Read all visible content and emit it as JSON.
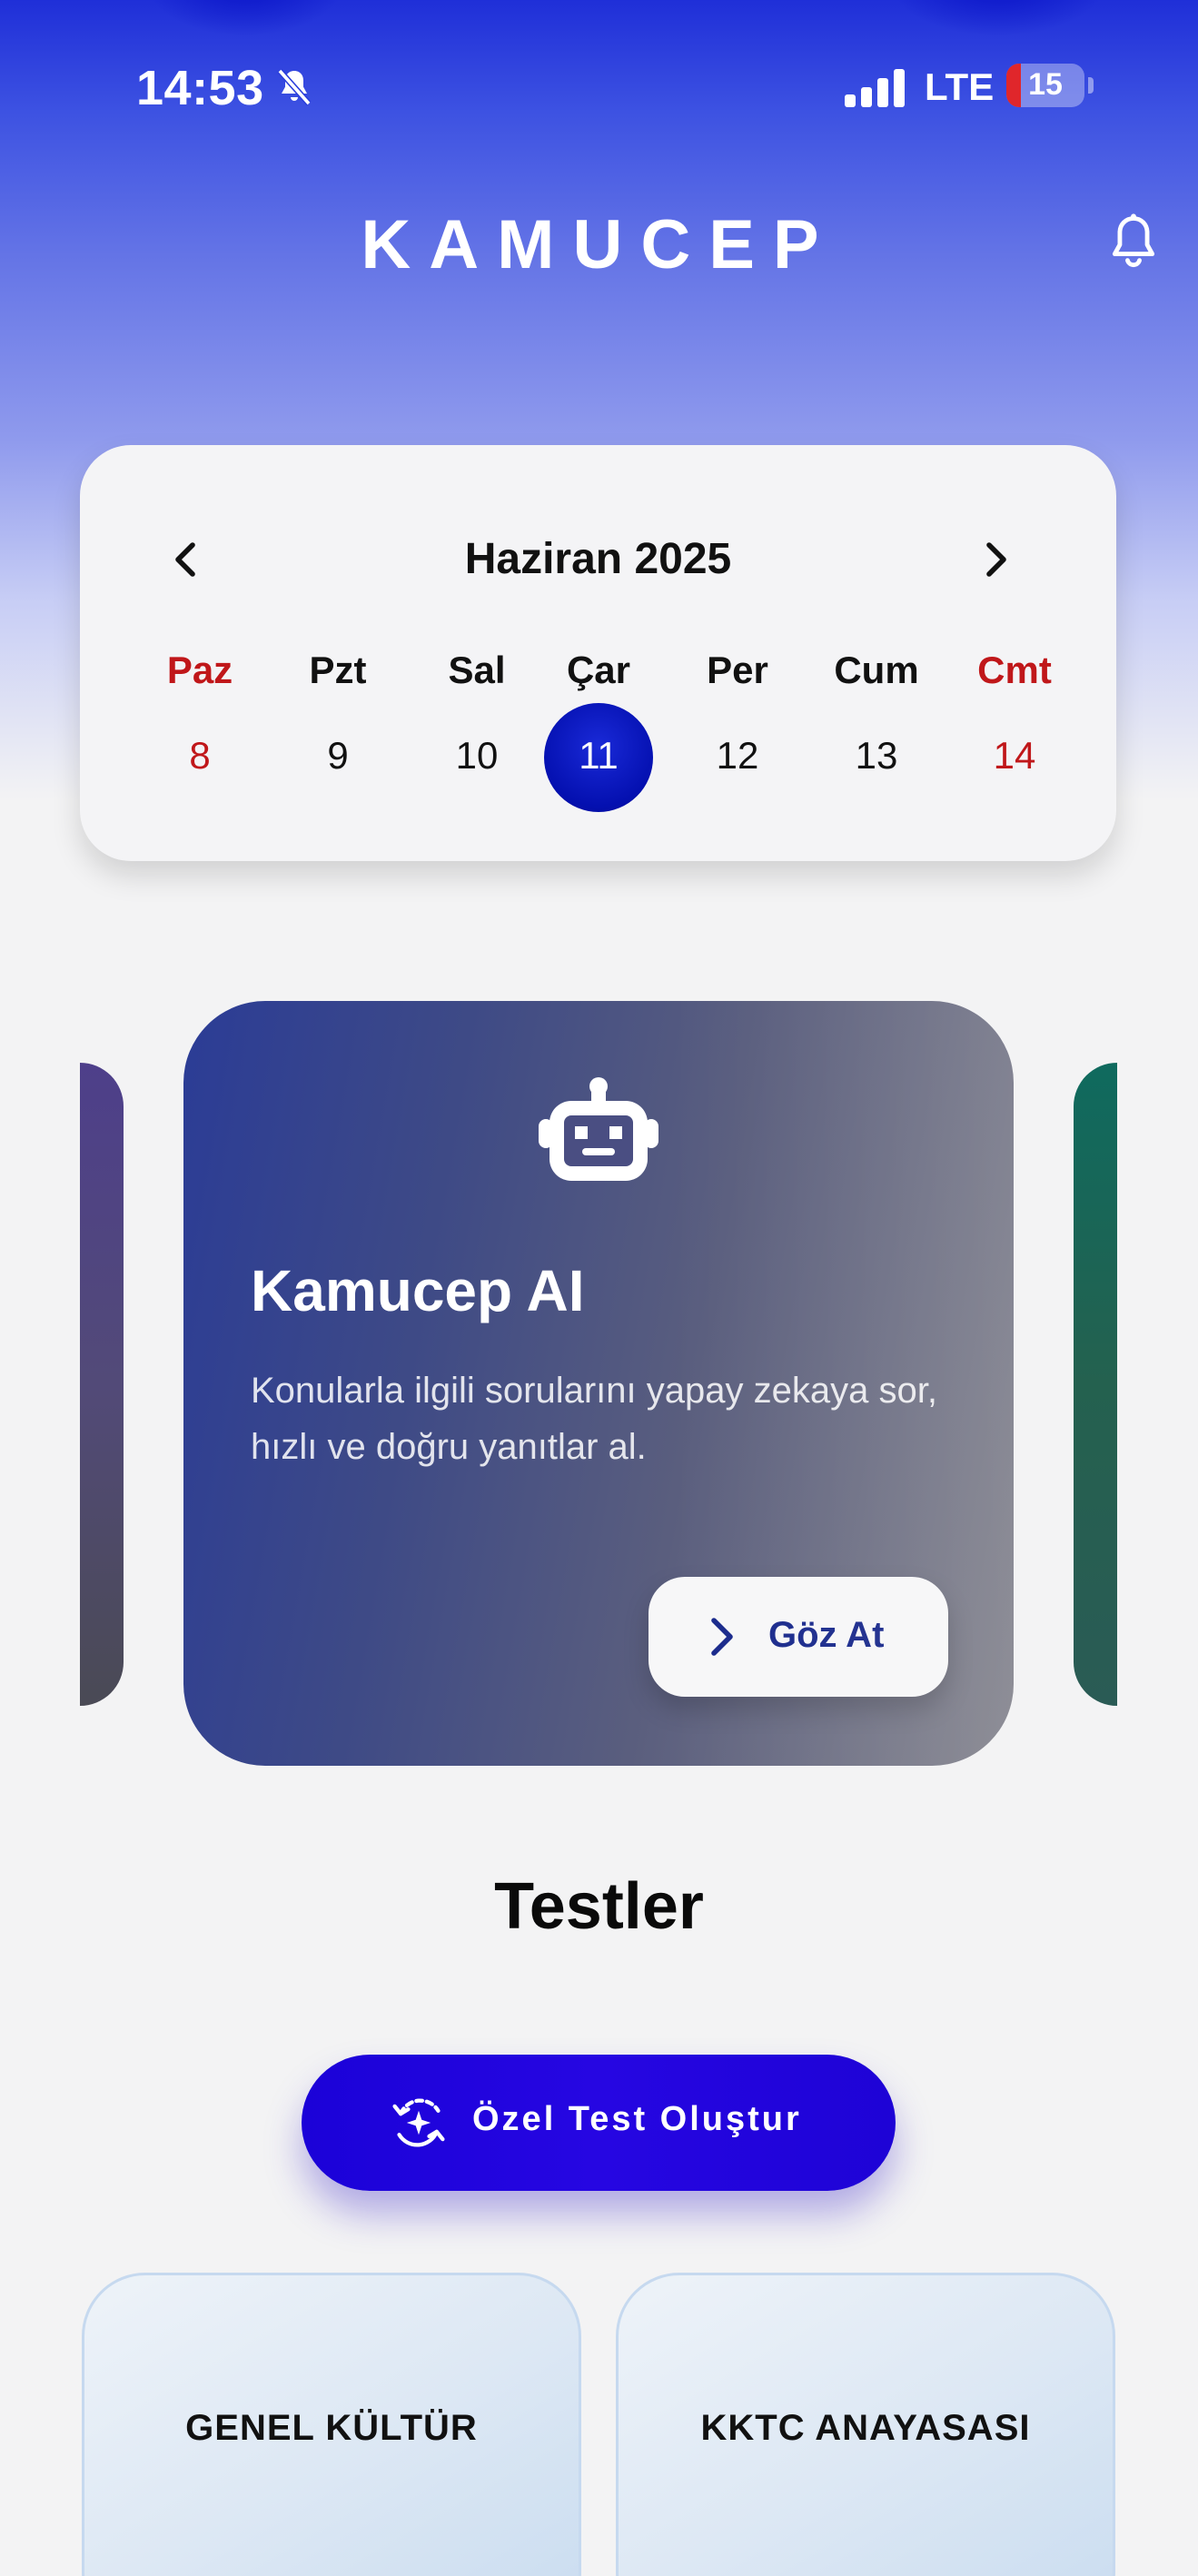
{
  "status_bar": {
    "time": "14:53",
    "network": "LTE",
    "battery": "15",
    "icons": [
      "bell-off-icon",
      "signal-icon",
      "battery-icon"
    ]
  },
  "header": {
    "brand": "KAMUCEP",
    "icon": "bell-icon"
  },
  "calendar": {
    "month_title": "Haziran 2025",
    "prev_icon": "chevron-left-icon",
    "next_icon": "chevron-right-icon",
    "weekdays": [
      "Paz",
      "Pzt",
      "Sal",
      "Çar",
      "Per",
      "Cum",
      "Cmt"
    ],
    "days": [
      "8",
      "9",
      "10",
      "11",
      "12",
      "13",
      "14"
    ],
    "selected_day": "11"
  },
  "carousel": {
    "active": {
      "icon": "robot-icon",
      "title": "Kamucep AI",
      "description": "Konularla ilgili sorularını yapay zekaya sor, hızlı ve doğru yanıtlar al.",
      "button_label": "Göz At"
    }
  },
  "tests": {
    "section_title": "Testler",
    "create_button": "Özel Test Oluştur",
    "categories": [
      "GENEL KÜLTÜR",
      "KKTC ANAYASASI"
    ]
  },
  "colors": {
    "accent": "#2606e2",
    "weekend": "#c0171a",
    "selected_day": "#0410b0"
  }
}
